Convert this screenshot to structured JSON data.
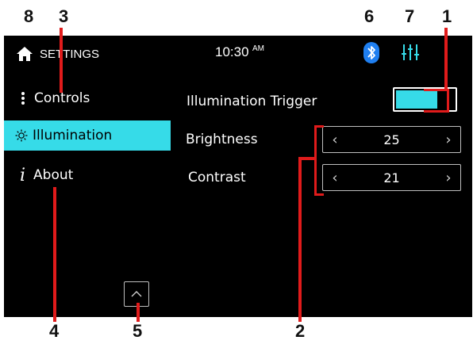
{
  "callouts": [
    "8",
    "3",
    "6",
    "7",
    "1",
    "4",
    "5",
    "2"
  ],
  "header": {
    "title": "SETTINGS",
    "time": "10:30",
    "ampm": "AM"
  },
  "sidebar": {
    "items": [
      {
        "label": "Controls"
      },
      {
        "label": "Illumination",
        "active": true
      },
      {
        "label": "About"
      }
    ]
  },
  "settings": {
    "illumination_trigger_label": "Illumination Trigger",
    "illumination_trigger_on": true,
    "brightness_label": "Brightness",
    "brightness_value": "25",
    "contrast_label": "Contrast",
    "contrast_value": "21"
  },
  "colors": {
    "accent": "#36dbe8",
    "bluetooth": "#1f7ff0",
    "callout_line": "#e01b1b",
    "screen_bg": "#000000"
  },
  "icons": [
    "home-icon",
    "bluetooth-icon",
    "equalizer-icon",
    "dots-icon",
    "sun-icon",
    "info-icon",
    "chevron-up-icon",
    "chevron-left-icon",
    "chevron-right-icon"
  ]
}
